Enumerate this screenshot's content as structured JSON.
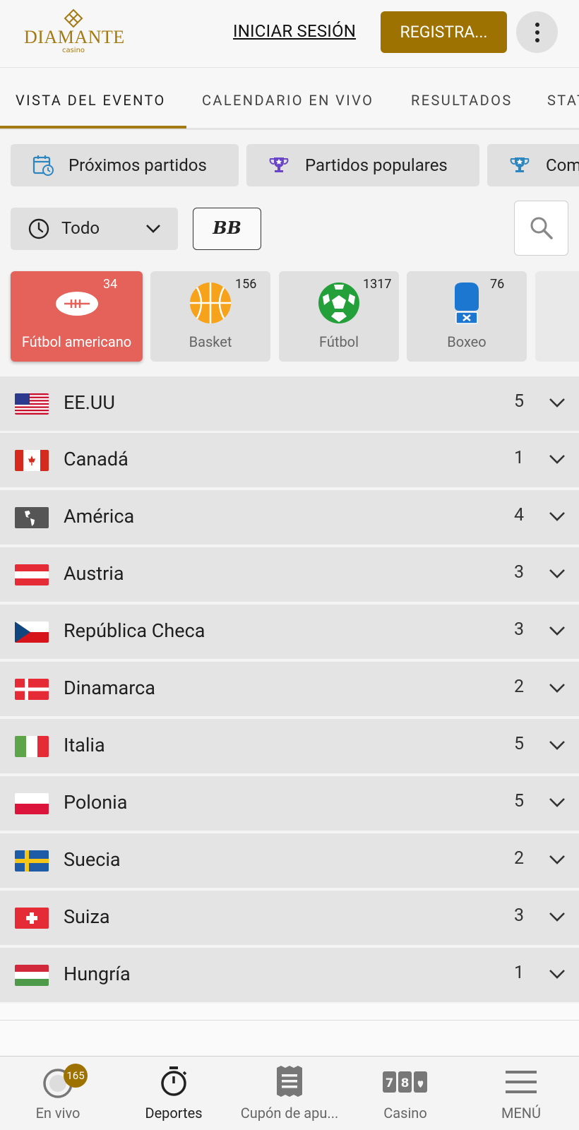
{
  "header": {
    "logo_text": "DIAMANTE",
    "logo_sub": "casino",
    "login_label": "INICIAR SESIÓN",
    "register_label": "REGISTRA..."
  },
  "tabs": [
    {
      "label": "VISTA DEL EVENTO",
      "active": true
    },
    {
      "label": "CALENDARIO EN VIVO"
    },
    {
      "label": "RESULTADOS"
    },
    {
      "label": "STAT"
    }
  ],
  "chips": [
    {
      "label": "Próximos partidos",
      "icon": "calendar-clock-icon"
    },
    {
      "label": "Partidos populares",
      "icon": "trophy-star-icon"
    },
    {
      "label": "Com",
      "icon": "trophy-star-icon"
    }
  ],
  "filter": {
    "time_label": "Todo",
    "bb_label": "BB"
  },
  "sports": [
    {
      "name": "Fútbol americano",
      "count": "34",
      "icon": "american-football-icon",
      "active": true
    },
    {
      "name": "Basket",
      "count": "156",
      "icon": "basketball-icon"
    },
    {
      "name": "Fútbol",
      "count": "1317",
      "icon": "soccer-ball-icon"
    },
    {
      "name": "Boxeo",
      "count": "76",
      "icon": "boxing-glove-icon"
    }
  ],
  "countries": [
    {
      "name": "EE.UU",
      "count": "5",
      "flag": "us-flag"
    },
    {
      "name": "Canadá",
      "count": "1",
      "flag": "canada-flag"
    },
    {
      "name": "América",
      "count": "4",
      "flag": "america-flag"
    },
    {
      "name": "Austria",
      "count": "3",
      "flag": "austria-flag"
    },
    {
      "name": "República Checa",
      "count": "3",
      "flag": "czech-flag"
    },
    {
      "name": "Dinamarca",
      "count": "2",
      "flag": "denmark-flag"
    },
    {
      "name": "Italia",
      "count": "5",
      "flag": "italy-flag"
    },
    {
      "name": "Polonia",
      "count": "5",
      "flag": "poland-flag"
    },
    {
      "name": "Suecia",
      "count": "2",
      "flag": "sweden-flag"
    },
    {
      "name": "Suiza",
      "count": "3",
      "flag": "switzerland-flag"
    },
    {
      "name": "Hungría",
      "count": "1",
      "flag": "hungary-flag"
    }
  ],
  "bottom_nav": [
    {
      "label": "En vivo",
      "badge": "165",
      "icon": "live-icon"
    },
    {
      "label": "Deportes",
      "icon": "stopwatch-icon",
      "active": true
    },
    {
      "label": "Cupón de apu...",
      "icon": "ticket-icon"
    },
    {
      "label": "Casino",
      "icon": "slot-machine-icon"
    },
    {
      "label": "MENÚ",
      "icon": "hamburger-icon"
    }
  ],
  "colors": {
    "brand": "#9e7200",
    "active_sport": "#e4625a",
    "chip_bg": "#e0e0e0"
  }
}
